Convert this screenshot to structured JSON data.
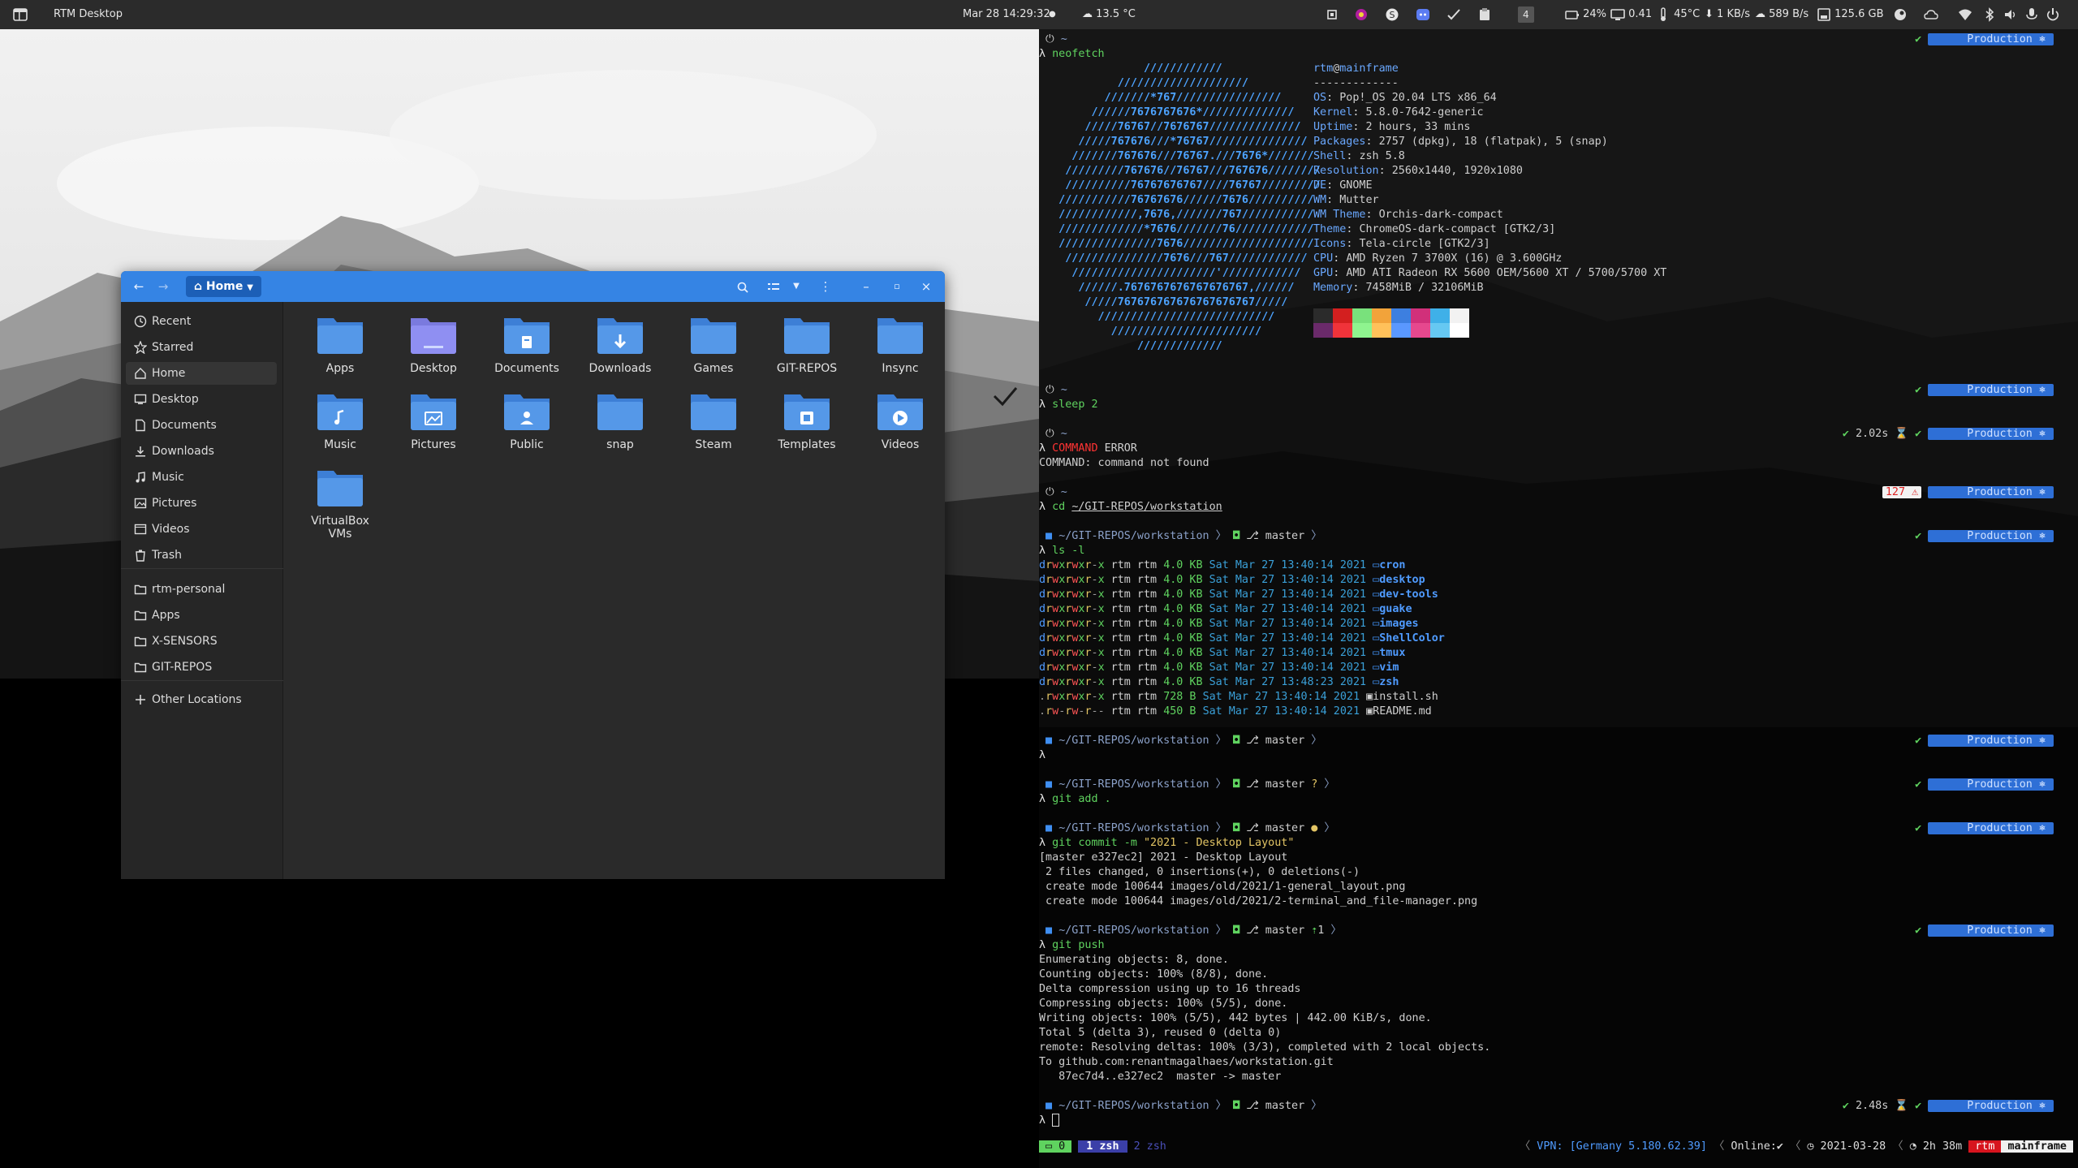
{
  "topbar": {
    "app_title": "RTM Desktop",
    "clock": "Mar 28  14:29:32",
    "dot": "●",
    "weather": "13.5 °C",
    "kbd": "4",
    "battery": "24%",
    "load": "0.41",
    "temp": "45°C",
    "net_down": "1 KB/s",
    "net_up": "589 B/s",
    "disk": "125.6 GB"
  },
  "file_manager": {
    "location": "Home",
    "sidebar": [
      {
        "label": "Recent",
        "icon": "clock-icon"
      },
      {
        "label": "Starred",
        "icon": "star-icon"
      },
      {
        "label": "Home",
        "icon": "home-icon"
      },
      {
        "label": "Desktop",
        "icon": "desktop-icon"
      },
      {
        "label": "Documents",
        "icon": "document-icon"
      },
      {
        "label": "Downloads",
        "icon": "download-icon"
      },
      {
        "label": "Music",
        "icon": "music-icon"
      },
      {
        "label": "Pictures",
        "icon": "picture-icon"
      },
      {
        "label": "Videos",
        "icon": "video-icon"
      },
      {
        "label": "Trash",
        "icon": "trash-icon"
      },
      {
        "label": "rtm-personal",
        "icon": "folder-icon"
      },
      {
        "label": "Apps",
        "icon": "folder-icon"
      },
      {
        "label": "X-SENSORS",
        "icon": "folder-icon"
      },
      {
        "label": "GIT-REPOS",
        "icon": "folder-icon"
      },
      {
        "label": "Other Locations",
        "icon": "plus-icon"
      }
    ],
    "folders": [
      "Apps",
      "Desktop",
      "Documents",
      "Downloads",
      "Games",
      "GIT-REPOS",
      "Insync",
      "Music",
      "Pictures",
      "Public",
      "snap",
      "Steam",
      "Templates",
      "Videos",
      "VirtualBox VMs"
    ]
  },
  "terminal": {
    "host_user": "rtm",
    "host_at": "@",
    "host_name": "mainframe",
    "dashes": "-------------",
    "neofetch_info": [
      {
        "k": "OS",
        "v": "Pop!_OS 20.04 LTS x86_64"
      },
      {
        "k": "Kernel",
        "v": "5.8.0-7642-generic"
      },
      {
        "k": "Uptime",
        "v": "2 hours, 33 mins"
      },
      {
        "k": "Packages",
        "v": "2757 (dpkg), 18 (flatpak), 5 (snap)"
      },
      {
        "k": "Shell",
        "v": "zsh 5.8"
      },
      {
        "k": "Resolution",
        "v": "2560x1440, 1920x1080"
      },
      {
        "k": "DE",
        "v": "GNOME"
      },
      {
        "k": "WM",
        "v": "Mutter"
      },
      {
        "k": "WM Theme",
        "v": "Orchis-dark-compact"
      },
      {
        "k": "Theme",
        "v": "ChromeOS-dark-compact [GTK2/3]"
      },
      {
        "k": "Icons",
        "v": "Tela-circle [GTK2/3]"
      },
      {
        "k": "CPU",
        "v": "AMD Ryzen 7 3700X (16) @ 3.600GHz"
      },
      {
        "k": "GPU",
        "v": "AMD ATI Radeon RX 5600 OEM/5600 XT / 5700/5700 XT"
      },
      {
        "k": "Memory",
        "v": "7458MiB / 32106MiB"
      }
    ],
    "palette": [
      "#2b2b2b",
      "#d31f1f",
      "#79e17c",
      "#f2a33a",
      "#3d7fe0",
      "#d1307a",
      "#3fb0e8",
      "#f2f2f2",
      "#6a2a6a",
      "#f0333a",
      "#8ff48f",
      "#ffc15a",
      "#5a98ff",
      "#e6488e",
      "#66c8f2",
      "#ffffff"
    ],
    "logo_lines": [
      "                ////////////",
      "            ////////////////////",
      "          ///////*767////////////////",
      "        //////7676767676*//////////////",
      "       /////76767//7676767//////////////",
      "      /////767676///*76767///////////////",
      "     ///////767676///76767.///7676*///////",
      "    /////////767676//76767///767676////////",
      "    //////////76767676767////76767/////////",
      "   ///////////76767676//////7676//////////",
      "   ////////////,7676,///////767///////////",
      "   /////////////*7676///////76////////////",
      "   ///////////////7676////////////////////",
      "    ///////////////7676///767////////////",
      "     //////////////////////'////////////",
      "      //////.7676767676767676767,//////",
      "       /////767676767676767676767/////",
      "         ///////////////////////////",
      "           ///////////////////////",
      "               /////////////"
    ],
    "home_tilde": "~",
    "cmd_neofetch": "neofetch",
    "cmd_sleep": "sleep 2",
    "cmd_error_1": "COMMAND",
    "cmd_error_2": "ERROR",
    "error_output": "COMMAND: command not found",
    "cmd_cd": "cd",
    "cd_path": "~/GIT-REPOS/workstation",
    "prompt_path": "~/GIT-REPOS/workstation",
    "branch": "master",
    "cmd_ls": "ls -l",
    "ls_rows": [
      {
        "perm": "drwxrwxr-x",
        "size": "4.0 KB",
        "date": "Sat Mar 27 13:40:14 2021",
        "name": "cron",
        "dir": true
      },
      {
        "perm": "drwxrwxr-x",
        "size": "4.0 KB",
        "date": "Sat Mar 27 13:40:14 2021",
        "name": "desktop",
        "dir": true
      },
      {
        "perm": "drwxrwxr-x",
        "size": "4.0 KB",
        "date": "Sat Mar 27 13:40:14 2021",
        "name": "dev-tools",
        "dir": true
      },
      {
        "perm": "drwxrwxr-x",
        "size": "4.0 KB",
        "date": "Sat Mar 27 13:40:14 2021",
        "name": "guake",
        "dir": true
      },
      {
        "perm": "drwxrwxr-x",
        "size": "4.0 KB",
        "date": "Sat Mar 27 13:40:14 2021",
        "name": "images",
        "dir": true
      },
      {
        "perm": "drwxrwxr-x",
        "size": "4.0 KB",
        "date": "Sat Mar 27 13:40:14 2021",
        "name": "ShellColor",
        "dir": true
      },
      {
        "perm": "drwxrwxr-x",
        "size": "4.0 KB",
        "date": "Sat Mar 27 13:40:14 2021",
        "name": "tmux",
        "dir": true
      },
      {
        "perm": "drwxrwxr-x",
        "size": "4.0 KB",
        "date": "Sat Mar 27 13:40:14 2021",
        "name": "vim",
        "dir": true
      },
      {
        "perm": "drwxrwxr-x",
        "size": "4.0 KB",
        "date": "Sat Mar 27 13:48:23 2021",
        "name": "zsh",
        "dir": true
      },
      {
        "perm": ".rwxrwxr-x",
        "size": "728 B",
        "date": "Sat Mar 27 13:40:14 2021",
        "name": "install.sh",
        "dir": false
      },
      {
        "perm": ".rw-rw-r--",
        "size": "450 B",
        "date": "Sat Mar 27 13:40:14 2021",
        "name": "README.md",
        "dir": false
      }
    ],
    "ls_owner": "rtm rtm",
    "cmd_git_add": "git add .",
    "cmd_git_commit": "git commit -m",
    "commit_msg": "\"2021 - Desktop Layout\"",
    "commit_output": [
      "[master e327ec2] 2021 - Desktop Layout",
      " 2 files changed, 0 insertions(+), 0 deletions(-)",
      " create mode 100644 images/old/2021/1-general_layout.png",
      " create mode 100644 images/old/2021/2-terminal_and_file-manager.png"
    ],
    "push_ahead": "1",
    "cmd_git_push": "git push",
    "push_output": [
      "Enumerating objects: 8, done.",
      "Counting objects: 100% (8/8), done.",
      "Delta compression using up to 16 threads",
      "Compressing objects: 100% (5/5), done.",
      "Writing objects: 100% (5/5), 442 bytes | 442.00 KiB/s, done.",
      "Total 5 (delta 3), reused 0 (delta 0)",
      "remote: Resolving deltas: 100% (3/3), completed with 2 local objects.",
      "To github.com:renantmagalhaes/workstation.git",
      "   87ec7d4..e327ec2  master -> master"
    ],
    "context": "Production",
    "time_sleep": "2.02s",
    "exit_code": "127",
    "time_push": "2.48s",
    "tmux": {
      "session": "0",
      "win_active": "1 zsh",
      "win_other": "2 zsh",
      "vpn": "VPN: [Germany 5.180.62.39]",
      "online": "Online:",
      "date": "2021-03-28",
      "uptime": "2h 38m",
      "user": "rtm",
      "host": "mainframe"
    }
  }
}
